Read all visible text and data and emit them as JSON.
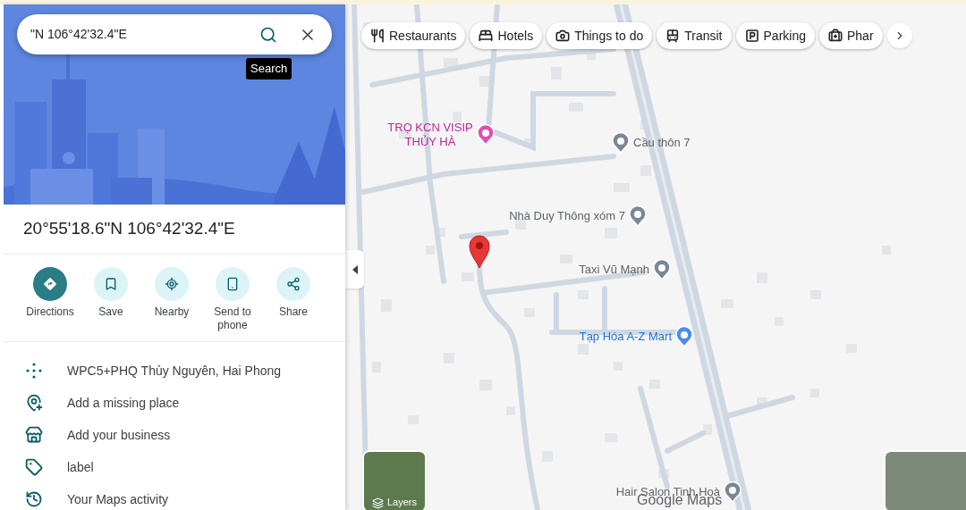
{
  "search": {
    "value": "\"N 106°42'32.4\"E",
    "tooltip": "Search"
  },
  "place": {
    "title": "20°55'18.6\"N 106°42'32.4\"E"
  },
  "actions": [
    {
      "kind": "directions",
      "label": "Directions",
      "filled": true
    },
    {
      "kind": "save",
      "label": "Save",
      "filled": false
    },
    {
      "kind": "nearby",
      "label": "Nearby",
      "filled": false
    },
    {
      "kind": "send",
      "label": "Send to phone",
      "filled": false
    },
    {
      "kind": "share",
      "label": "Share",
      "filled": false
    }
  ],
  "details": [
    {
      "kind": "plus-code",
      "text": "WPC5+PHQ Thủy Nguyên, Hai Phong"
    },
    {
      "kind": "add-place",
      "text": "Add a missing place"
    },
    {
      "kind": "add-business",
      "text": "Add your business"
    },
    {
      "kind": "label",
      "text": "label"
    },
    {
      "kind": "activity",
      "text": "Your Maps activity"
    }
  ],
  "chips": [
    {
      "kind": "restaurants",
      "label": "Restaurants"
    },
    {
      "kind": "hotels",
      "label": "Hotels"
    },
    {
      "kind": "things",
      "label": "Things to do"
    },
    {
      "kind": "transit",
      "label": "Transit"
    },
    {
      "kind": "parking",
      "label": "Parking"
    },
    {
      "kind": "pharmacy",
      "label": "Phar"
    }
  ],
  "map": {
    "places": [
      {
        "kind": "hotel",
        "name": "TRỌ KCN VISIP THỦY HÀ"
      },
      {
        "kind": "bridge",
        "name": "Cầu thôn 7"
      },
      {
        "kind": "generic",
        "name": "Nhà Duy Thông xóm 7"
      },
      {
        "kind": "generic",
        "name": "Taxi Vũ Mạnh"
      },
      {
        "kind": "shop",
        "name": "Tạp Hóa A-Z Mart"
      },
      {
        "kind": "generic",
        "name": "Hair Salon Tinh Hoà"
      }
    ],
    "layers_label": "Layers",
    "brand": "Google Maps"
  }
}
